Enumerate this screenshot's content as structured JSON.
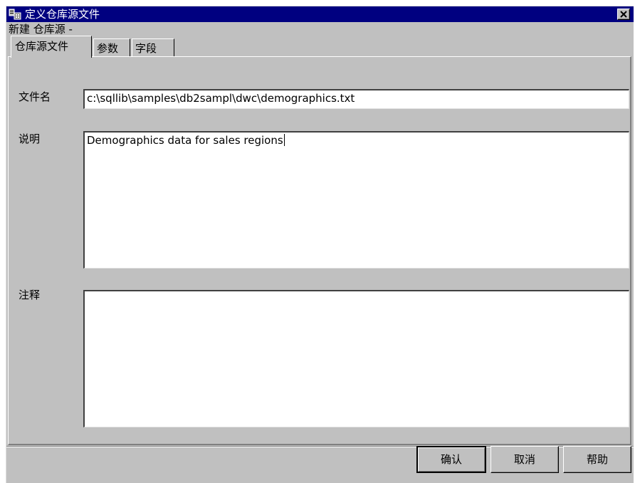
{
  "window": {
    "title": "定义仓库源文件",
    "subtitle": "新建 仓库源 -",
    "title_icon": "warehouse-app-icon",
    "close_icon": "close-icon"
  },
  "tabs": [
    {
      "label": "仓库源文件",
      "active": true
    },
    {
      "label": "参数",
      "active": false
    },
    {
      "label": "字段",
      "active": false
    }
  ],
  "fields": {
    "filename": {
      "label": "文件名",
      "value": "c:\\sqllib\\samples\\db2sampl\\dwc\\demographics.txt"
    },
    "description": {
      "label": "说明",
      "value": "Demographics data for sales regions"
    },
    "comments": {
      "label": "注释",
      "value": ""
    }
  },
  "buttons": {
    "ok": "确认",
    "cancel": "取消",
    "help": "帮助"
  },
  "colors": {
    "titlebar": "#000080",
    "face": "#c0c0c0",
    "field_bg": "#ffffff"
  }
}
